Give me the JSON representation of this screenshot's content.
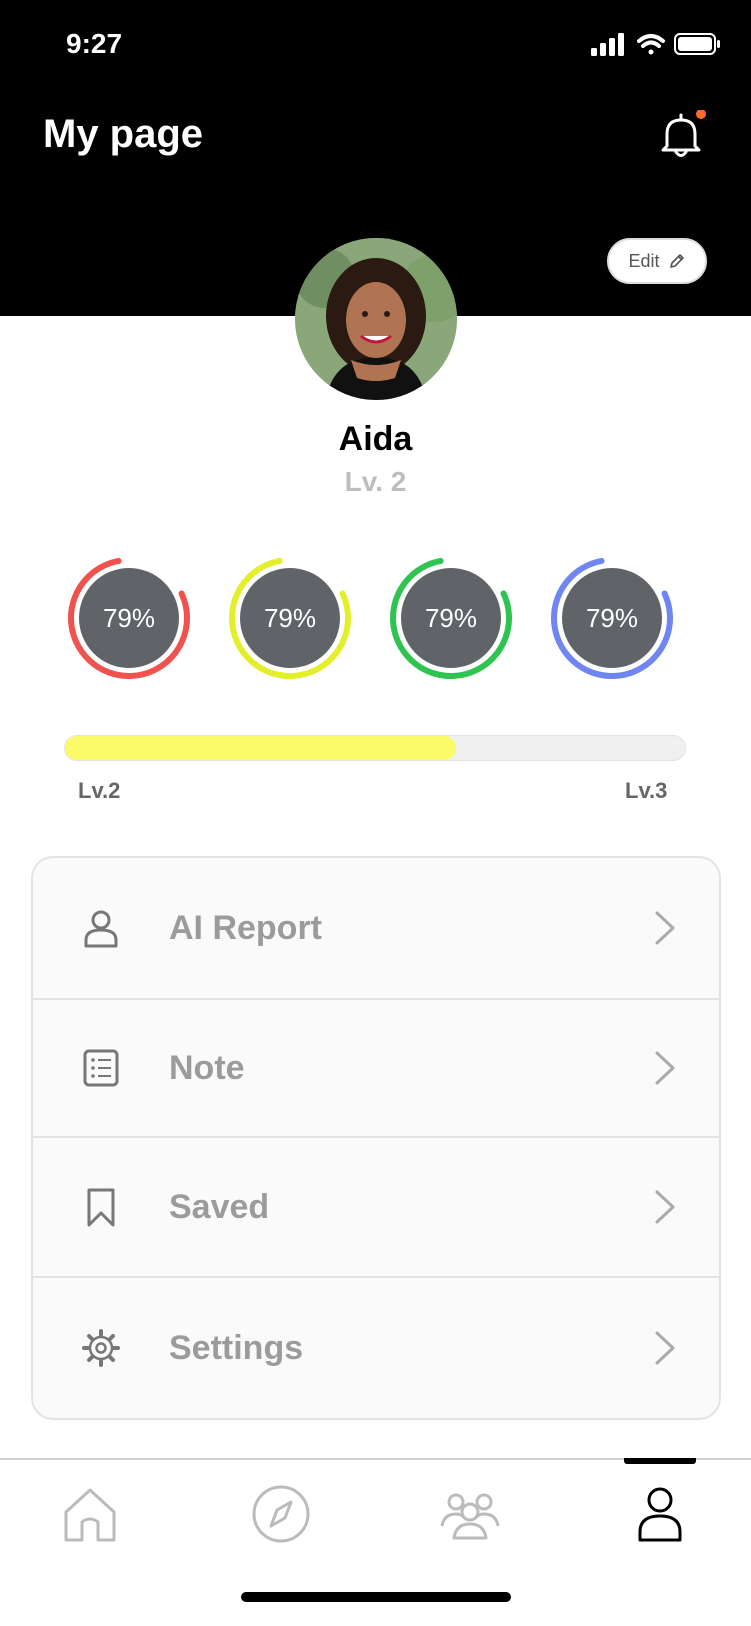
{
  "status_bar": {
    "time": "9:27"
  },
  "header": {
    "title": "My page",
    "edit_label": "Edit",
    "notification_color": "#ff6b2b"
  },
  "profile": {
    "name": "Aida",
    "level": "Lv. 2"
  },
  "stats": [
    {
      "label": "79%",
      "value": 0.79,
      "color": "#f0524d"
    },
    {
      "label": "79%",
      "value": 0.79,
      "color": "#e2ef2a"
    },
    {
      "label": "79%",
      "value": 0.79,
      "color": "#2fc44f"
    },
    {
      "label": "79%",
      "value": 0.79,
      "color": "#6f85f2"
    }
  ],
  "progress": {
    "value": 0.63,
    "start_label": "Lv.2",
    "end_label": "Lv.3",
    "color": "#fbfb6a"
  },
  "menu": [
    {
      "label": "AI Report",
      "icon": "user-icon"
    },
    {
      "label": "Note",
      "icon": "note-icon"
    },
    {
      "label": "Saved",
      "icon": "bookmark-icon"
    },
    {
      "label": "Settings",
      "icon": "gear-icon"
    }
  ],
  "tabbar": [
    {
      "icon": "home-icon",
      "active": false
    },
    {
      "icon": "compass-icon",
      "active": false
    },
    {
      "icon": "community-icon",
      "active": false
    },
    {
      "icon": "profile-icon",
      "active": true
    }
  ]
}
